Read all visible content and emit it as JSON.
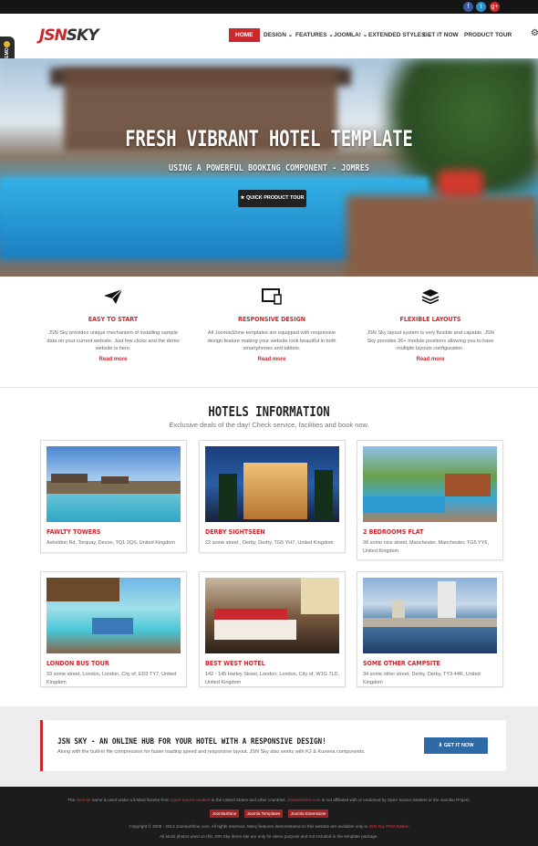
{
  "colors": {
    "accent": "#c8282e",
    "dark": "#151515",
    "button_blue": "#2e6aa6"
  },
  "social": [
    "f",
    "t",
    "g+"
  ],
  "logo": {
    "part1": "JSN",
    "part2": "SKY"
  },
  "nav": [
    {
      "label": "HOME",
      "active": true
    },
    {
      "label": "DESIGN ⌄"
    },
    {
      "label": "FEATURES ⌄"
    },
    {
      "label": "JOOMLA! ⌄"
    },
    {
      "label": "EXTENDED STYLES ⌄"
    },
    {
      "label": "GET IT NOW"
    },
    {
      "label": "PRODUCT TOUR"
    }
  ],
  "demo_tab": "BUILD YOUR DEMO",
  "hero": {
    "title": "FRESH VIBRANT HOTEL TEMPLATE",
    "subtitle": "USING A POWERFUL BOOKING COMPONENT - JOMRES",
    "button": "QUICK PRODUCT TOUR"
  },
  "features": [
    {
      "icon": "paper-plane-icon",
      "title": "EASY TO START",
      "desc": "JSN Sky provides unique mechanism of installing sample data on your current website. Just few clicks and the demo website is here.",
      "more": "Read more"
    },
    {
      "icon": "devices-icon",
      "title": "RESPONSIVE DESIGN",
      "desc": "All JoomlaShine templates are equipped with responsive design feature making your website look beautiful in both smartphones and tablets.",
      "more": "Read more"
    },
    {
      "icon": "layers-icon",
      "title": "FLEXIBLE LAYOUTS",
      "desc": "JSN Sky layout system is very flexible and capable. JSN Sky provides 36+ module positions allowing you to have multiple layouts configuration.",
      "more": "Read more"
    }
  ],
  "hotels": {
    "title": "HOTELS INFORMATION",
    "subtitle": "Exclusive deals of the day! Check service, facilities and book now.",
    "items": [
      {
        "name": "FAWLTY TOWERS",
        "address": "Asheldon Rd, Torquay, Devon, TQ1 2QS, United Kingdom"
      },
      {
        "name": "DERBY SIGHTSEEN",
        "address": "22 some street , Derby, Derby, TG5 YH7, United Kingdom"
      },
      {
        "name": "2 BEDROOMS FLAT",
        "address": "99 some nice street, Manchester, Manchester, TG5 YY6, United Kingdom"
      },
      {
        "name": "LONDON BUS TOUR",
        "address": "33 some street, London, London, City of, ED3 TY7, United Kingdom"
      },
      {
        "name": "BEST WEST HOTEL",
        "address": "142 - 145 Harley Street, London, London, City of, W1G 7LD, United Kingdom"
      },
      {
        "name": "SOME OTHER CAMPSITE",
        "address": "34 some other street, Derby, Derby, TY3 44R, United Kingdom"
      }
    ]
  },
  "cta": {
    "title": "JSN SKY - AN ONLINE HUB FOR YOUR HOTEL WITH A RESPONSIVE DESIGN!",
    "text": "Along with the built-in file compression for faster loading speed and responsive layout, JSN Sky also works with K2 & Kunena components.",
    "button": "GET IT NOW"
  },
  "footer": {
    "line1_a": "The",
    "line1_b": "Joomla!",
    "line1_c": "name is used under a limited license from",
    "line1_d": "Open Source Matters",
    "line1_e": "in the United States and other countries.",
    "line1_f": "JoomlaShine.com",
    "line1_g": "is not affiliated with or endorsed by Open Source Matters or the Joomla! Project.",
    "tags": [
      "JoomlaShine",
      "Joomla Templates",
      "Joomla Extensions"
    ],
    "line3_a": "Copyright © 2008 - 2013 JoomlaShine.com. All rights reserved. Many features demonstrated on this website are available only in",
    "line3_b": "JSN Sky PRO Edition",
    "line4": "All stock photos used on this JSN Sky demo site are only for demo purpose and not included in the template package."
  }
}
